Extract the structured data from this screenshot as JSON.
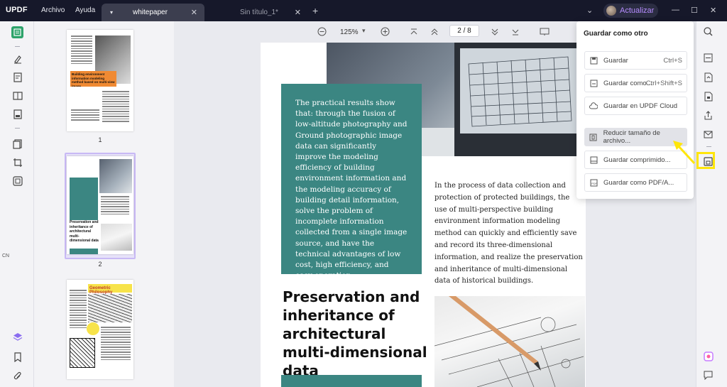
{
  "app": {
    "logo_main": "UPDF",
    "menu": [
      "Archivo",
      "Ayuda"
    ],
    "tabs": [
      {
        "label": "whitepaper",
        "active": true
      },
      {
        "label": "Sin título_1*",
        "active": false
      }
    ],
    "upgrade_label": "Actualizar"
  },
  "toolbar": {
    "zoom": "125%",
    "page_current": "2",
    "page_total": "8",
    "page_separator": "/"
  },
  "thumbnails": {
    "pages": [
      {
        "number": "1",
        "title": "Building environment information modeling method based on multi-view image"
      },
      {
        "number": "2",
        "title": "Preservation and inheritance of architectural multi-dimensional data"
      },
      {
        "number": "3",
        "title": "Geometric Philosophy"
      }
    ]
  },
  "side_lang": "CN",
  "document": {
    "teal_paragraph": "The practical results show that: through the fusion of low-altitude photography and Ground photographic image data can significantly improve the modeling efficiency of building environment information and the modeling accuracy of building detail information, solve the problem of incomplete information collected from a single image source, and have the technical advantages of low cost, high efficiency, and easy operation.",
    "right_paragraph": "In the process of data collection and protection of protected buildings, the use of multi-perspective building environment information modeling method can quickly and efficiently save and record its three-dimensional information, and realize the preservation and inheritance of multi-dimensional data of historical buildings.",
    "heading": "Preservation and inheritance of architectural multi-dimensional data"
  },
  "save_menu": {
    "title": "Guardar como otro",
    "items": [
      {
        "label": "Guardar",
        "shortcut": "Ctrl+S",
        "icon": "save-icon",
        "highlighted": false
      },
      {
        "label": "Guardar como...",
        "shortcut": "Ctrl+Shift+S",
        "icon": "save-as-icon",
        "highlighted": false
      },
      {
        "label": "Guardar en UPDF Cloud",
        "shortcut": "",
        "icon": "cloud-icon",
        "highlighted": false
      },
      {
        "label": "Reducir tamaño de archivo...",
        "shortcut": "",
        "icon": "reduce-size-icon",
        "highlighted": true
      },
      {
        "label": "Guardar comprimido...",
        "shortcut": "",
        "icon": "compress-icon",
        "highlighted": false
      },
      {
        "label": "Guardar como PDF/A...",
        "shortcut": "",
        "icon": "pdfa-icon",
        "highlighted": false
      }
    ]
  },
  "colors": {
    "titlebar": "#16182a",
    "teal": "#3b8682",
    "highlight": "#ffe60a",
    "accent_orange": "#f08a33",
    "accent_yellow": "#f7e34a"
  }
}
